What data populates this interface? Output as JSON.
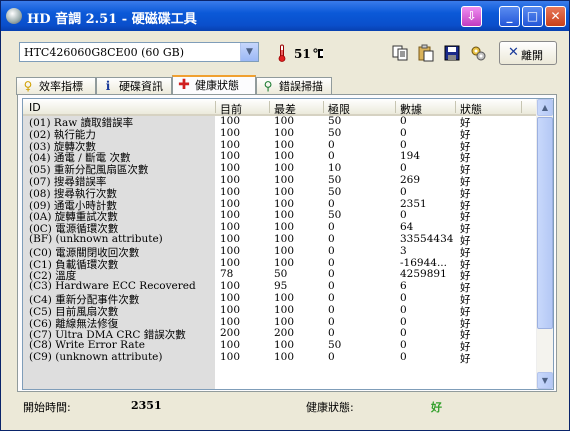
{
  "window": {
    "title": "HD 音調 2.51 - 硬磁碟工具",
    "title_buttons": [
      "download",
      "minimize",
      "maximize",
      "close"
    ]
  },
  "toolbar": {
    "drive": "HTC426060G8CE00 (60 GB)",
    "temperature": "51",
    "temperature_unit_icon": "celsius-icon",
    "icons": [
      "copy-icon",
      "paste-icon",
      "save-icon",
      "settings-icon"
    ],
    "exit_label": "離開"
  },
  "tabs": [
    {
      "label": "效率指標",
      "icon": "bulb-icon"
    },
    {
      "label": "硬碟資訊",
      "icon": "info-icon"
    },
    {
      "label": "健康狀態",
      "icon": "health-cross-icon",
      "active": true
    },
    {
      "label": "錯誤掃描",
      "icon": "search-icon"
    }
  ],
  "table": {
    "columns": [
      "ID",
      "目前",
      "最差",
      "極限",
      "數據",
      "狀態"
    ],
    "rows": [
      [
        "(01) Raw 讀取錯誤率",
        "100",
        "100",
        "50",
        "0",
        "好"
      ],
      [
        "(02) 執行能力",
        "100",
        "100",
        "50",
        "0",
        "好"
      ],
      [
        "(03) 旋轉次數",
        "100",
        "100",
        "0",
        "0",
        "好"
      ],
      [
        "(04) 通電 / 斷電 次數",
        "100",
        "100",
        "0",
        "194",
        "好"
      ],
      [
        "(05) 重新分配風扇區次數",
        "100",
        "100",
        "10",
        "0",
        "好"
      ],
      [
        "(07) 搜尋錯誤率",
        "100",
        "100",
        "50",
        "269",
        "好"
      ],
      [
        "(08) 搜尋執行次數",
        "100",
        "100",
        "50",
        "0",
        "好"
      ],
      [
        "(09) 通電小時計數",
        "100",
        "100",
        "0",
        "2351",
        "好"
      ],
      [
        "(0A) 旋轉重試次數",
        "100",
        "100",
        "50",
        "0",
        "好"
      ],
      [
        "(0C) 電源循環次數",
        "100",
        "100",
        "0",
        "64",
        "好"
      ],
      [
        "(BF) (unknown attribute)",
        "100",
        "100",
        "0",
        "33554434",
        "好"
      ],
      [
        "(C0) 電源關閉收回次數",
        "100",
        "100",
        "0",
        "3",
        "好"
      ],
      [
        "(C1) 負載循環次數",
        "100",
        "100",
        "0",
        "-16944...",
        "好"
      ],
      [
        "(C2) 溫度",
        "78",
        "50",
        "0",
        "4259891",
        "好"
      ],
      [
        "(C3) Hardware ECC Recovered",
        "100",
        "95",
        "0",
        "6",
        "好"
      ],
      [
        "(C4) 重新分配事件次數",
        "100",
        "100",
        "0",
        "0",
        "好"
      ],
      [
        "(C5) 目前風扇次數",
        "100",
        "100",
        "0",
        "0",
        "好"
      ],
      [
        "(C6) 離線無法修復",
        "100",
        "100",
        "0",
        "0",
        "好"
      ],
      [
        "(C7) Ultra DMA CRC 錯誤次數",
        "200",
        "200",
        "0",
        "0",
        "好"
      ],
      [
        "(C8) Write Error Rate",
        "100",
        "100",
        "50",
        "0",
        "好"
      ],
      [
        "(C9) (unknown attribute)",
        "100",
        "100",
        "0",
        "0",
        "好"
      ]
    ]
  },
  "footer": {
    "start_time_label": "開始時間:",
    "start_time_value": "2351",
    "health_label": "健康狀態:",
    "health_value": "好"
  },
  "colors": {
    "health_ok": "#33a02c",
    "title_bar": "#0a4fcc"
  }
}
